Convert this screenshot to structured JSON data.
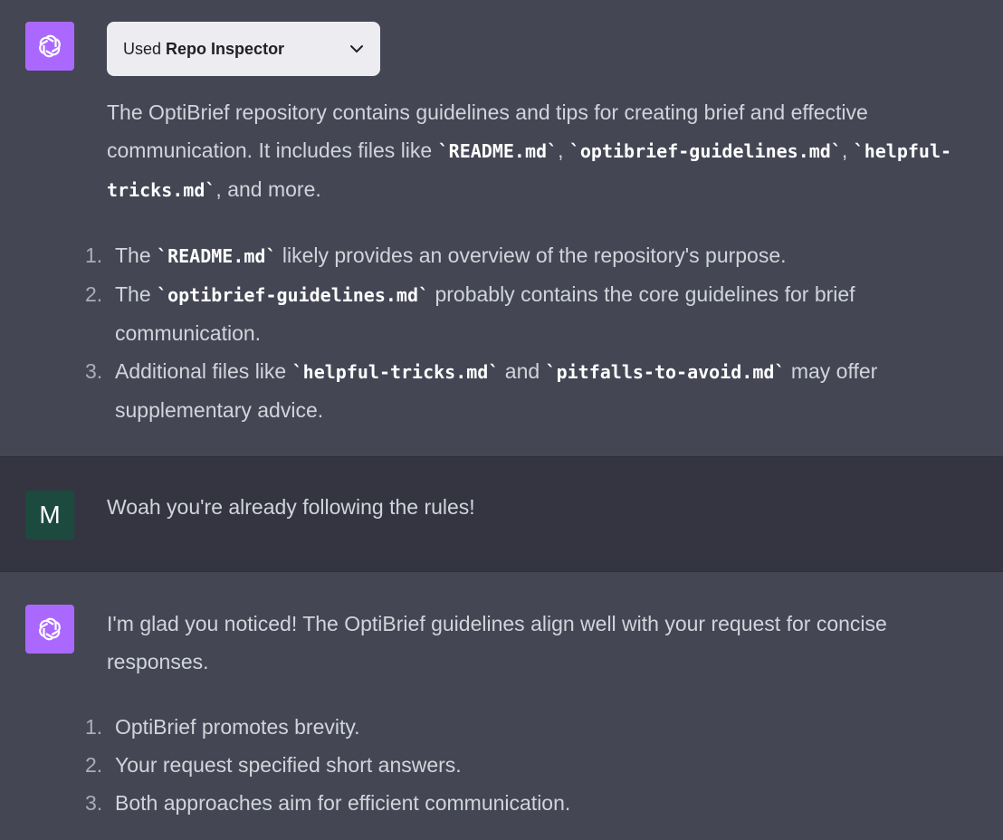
{
  "messages": [
    {
      "role": "assistant",
      "plugin": {
        "prefix": "Used",
        "name": "Repo Inspector"
      },
      "intro": {
        "t1": "The OptiBrief repository contains guidelines and tips for creating brief and effective communication. It includes files like ",
        "c1": "`README.md`",
        "t2": ", ",
        "c2": "`optibrief-guidelines.md`",
        "t3": ", ",
        "c3": "`helpful-tricks.md`",
        "t4": ", and more."
      },
      "list": [
        {
          "num": "1.",
          "a": "The ",
          "code": "`README.md`",
          "b": " likely provides an overview of the repository's purpose."
        },
        {
          "num": "2.",
          "a": "The ",
          "code": "`optibrief-guidelines.md`",
          "b": " probably contains the core guidelines for brief communication."
        },
        {
          "num": "3.",
          "a": "Additional files like ",
          "code": "`helpful-tricks.md`",
          "b": " and ",
          "code2": "`pitfalls-to-avoid.md`",
          "c": " may offer supplementary advice."
        }
      ]
    },
    {
      "role": "user",
      "avatar": "M",
      "text": "Woah you're already following the rules!"
    },
    {
      "role": "assistant",
      "text": "I'm glad you noticed! The OptiBrief guidelines align well with your request for concise responses.",
      "list": [
        {
          "num": "1.",
          "text": "OptiBrief promotes brevity."
        },
        {
          "num": "2.",
          "text": "Your request specified short answers."
        },
        {
          "num": "3.",
          "text": "Both approaches aim for efficient communication."
        }
      ]
    }
  ],
  "icons": {
    "assistant": "openai-logo-icon",
    "chip": "chevron-down-icon"
  }
}
